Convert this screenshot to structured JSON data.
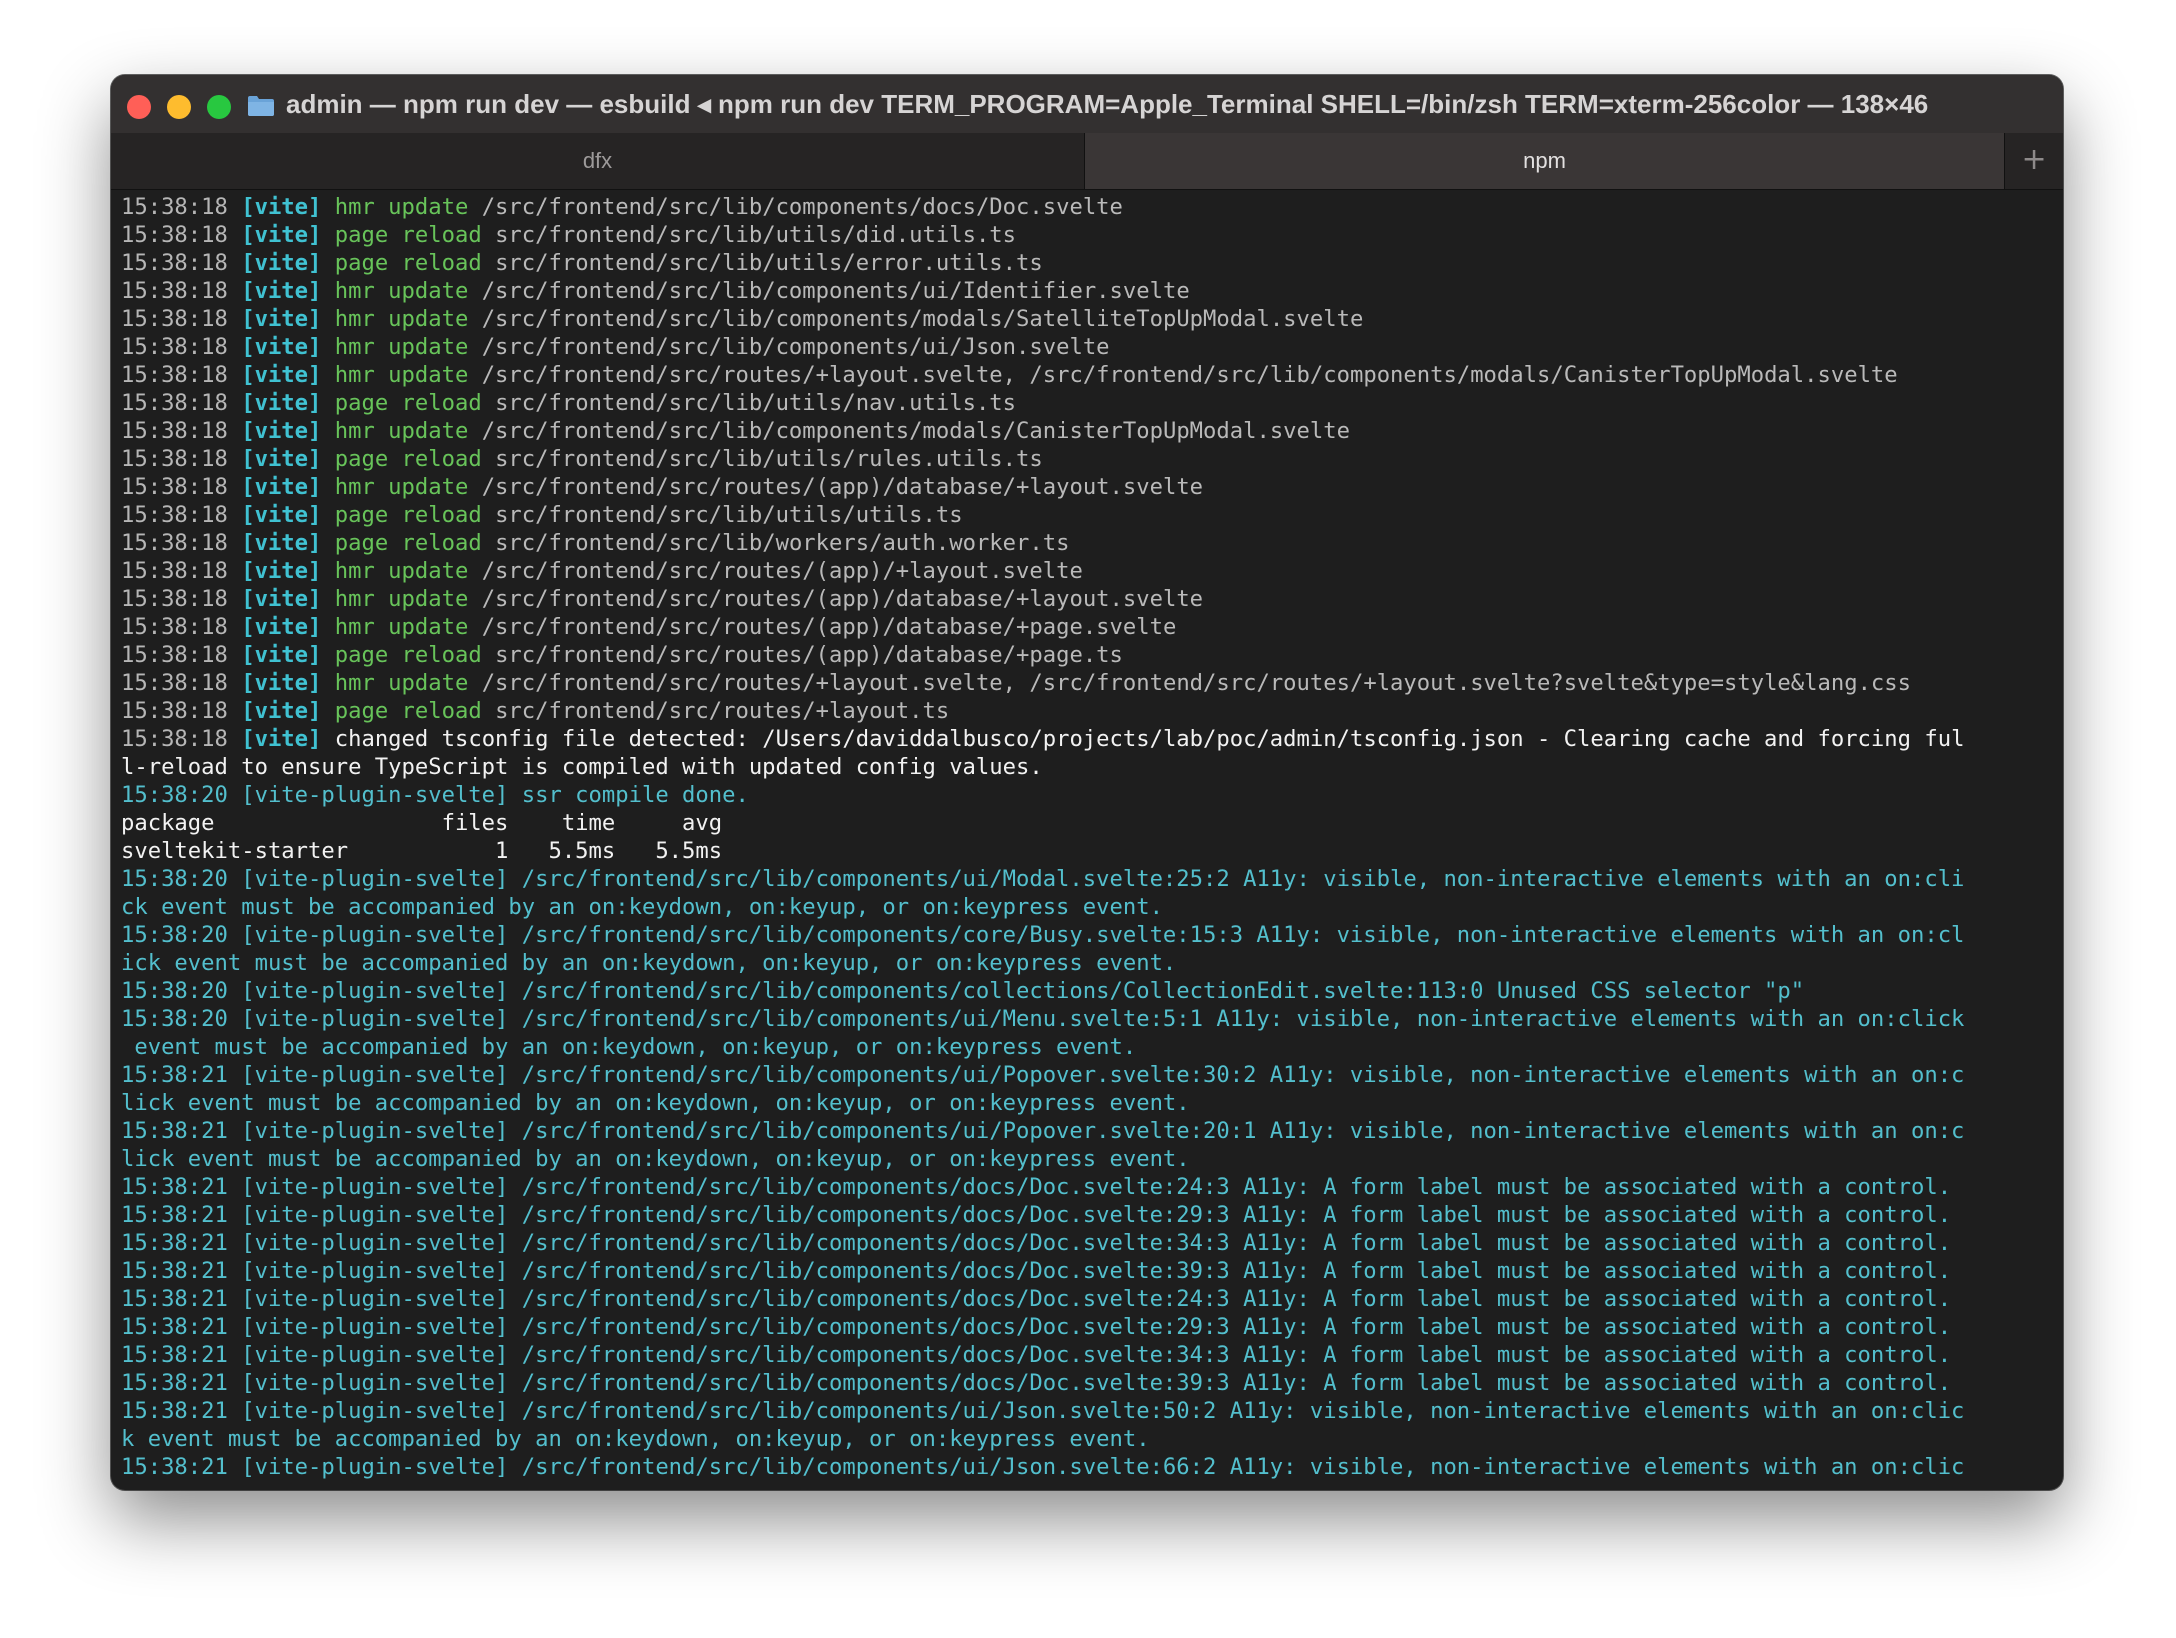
{
  "window": {
    "title": "admin — npm run dev — esbuild ◂ npm run dev TERM_PROGRAM=Apple_Terminal SHELL=/bin/zsh TERM=xterm-256color — 138×46",
    "folder_icon": "folder-icon",
    "colors": {
      "close": "#ff5f57",
      "minimize": "#febc2e",
      "maximize": "#28c840"
    }
  },
  "tabs": [
    {
      "label": "dfx",
      "active": false
    },
    {
      "label": "npm",
      "active": true
    }
  ],
  "new_tab_label": "+",
  "vite_lines": [
    {
      "ts": "15:38:18",
      "tag": "[vite]",
      "action": "hmr update",
      "path": "/src/frontend/src/lib/components/docs/Doc.svelte"
    },
    {
      "ts": "15:38:18",
      "tag": "[vite]",
      "action": "page reload",
      "path": "src/frontend/src/lib/utils/did.utils.ts"
    },
    {
      "ts": "15:38:18",
      "tag": "[vite]",
      "action": "page reload",
      "path": "src/frontend/src/lib/utils/error.utils.ts"
    },
    {
      "ts": "15:38:18",
      "tag": "[vite]",
      "action": "hmr update",
      "path": "/src/frontend/src/lib/components/ui/Identifier.svelte"
    },
    {
      "ts": "15:38:18",
      "tag": "[vite]",
      "action": "hmr update",
      "path": "/src/frontend/src/lib/components/modals/SatelliteTopUpModal.svelte"
    },
    {
      "ts": "15:38:18",
      "tag": "[vite]",
      "action": "hmr update",
      "path": "/src/frontend/src/lib/components/ui/Json.svelte"
    },
    {
      "ts": "15:38:18",
      "tag": "[vite]",
      "action": "hmr update",
      "path": "/src/frontend/src/routes/+layout.svelte, /src/frontend/src/lib/components/modals/CanisterTopUpModal.svelte"
    },
    {
      "ts": "15:38:18",
      "tag": "[vite]",
      "action": "page reload",
      "path": "src/frontend/src/lib/utils/nav.utils.ts"
    },
    {
      "ts": "15:38:18",
      "tag": "[vite]",
      "action": "hmr update",
      "path": "/src/frontend/src/lib/components/modals/CanisterTopUpModal.svelte"
    },
    {
      "ts": "15:38:18",
      "tag": "[vite]",
      "action": "page reload",
      "path": "src/frontend/src/lib/utils/rules.utils.ts"
    },
    {
      "ts": "15:38:18",
      "tag": "[vite]",
      "action": "hmr update",
      "path": "/src/frontend/src/routes/(app)/database/+layout.svelte"
    },
    {
      "ts": "15:38:18",
      "tag": "[vite]",
      "action": "page reload",
      "path": "src/frontend/src/lib/utils/utils.ts"
    },
    {
      "ts": "15:38:18",
      "tag": "[vite]",
      "action": "page reload",
      "path": "src/frontend/src/lib/workers/auth.worker.ts"
    },
    {
      "ts": "15:38:18",
      "tag": "[vite]",
      "action": "hmr update",
      "path": "/src/frontend/src/routes/(app)/+layout.svelte"
    },
    {
      "ts": "15:38:18",
      "tag": "[vite]",
      "action": "hmr update",
      "path": "/src/frontend/src/routes/(app)/database/+layout.svelte"
    },
    {
      "ts": "15:38:18",
      "tag": "[vite]",
      "action": "hmr update",
      "path": "/src/frontend/src/routes/(app)/database/+page.svelte"
    },
    {
      "ts": "15:38:18",
      "tag": "[vite]",
      "action": "page reload",
      "path": "src/frontend/src/routes/(app)/database/+page.ts"
    },
    {
      "ts": "15:38:18",
      "tag": "[vite]",
      "action": "hmr update",
      "path": "/src/frontend/src/routes/+layout.svelte, /src/frontend/src/routes/+layout.svelte?svelte&type=style&lang.css"
    },
    {
      "ts": "15:38:18",
      "tag": "[vite]",
      "action": "page reload",
      "path": "src/frontend/src/routes/+layout.ts"
    }
  ],
  "tsconfig_line": {
    "ts": "15:38:18",
    "tag": "[vite]",
    "text1": "changed tsconfig file detected: /Users/daviddalbusco/projects/lab/poc/admin/tsconfig.json - Clearing cache and forcing ful",
    "text2": "l-reload to ensure TypeScript is compiled with updated config values."
  },
  "compile_done": "15:38:20 [vite-plugin-svelte] ssr compile done.",
  "table": {
    "header": "package                 files    time     avg",
    "row": "sveltekit-starter           1   5.5ms   5.5ms"
  },
  "plugin_lines": [
    "15:38:20 [vite-plugin-svelte] /src/frontend/src/lib/components/ui/Modal.svelte:25:2 A11y: visible, non-interactive elements with an on:cli",
    "ck event must be accompanied by an on:keydown, on:keyup, or on:keypress event.",
    "15:38:20 [vite-plugin-svelte] /src/frontend/src/lib/components/core/Busy.svelte:15:3 A11y: visible, non-interactive elements with an on:cl",
    "ick event must be accompanied by an on:keydown, on:keyup, or on:keypress event.",
    "15:38:20 [vite-plugin-svelte] /src/frontend/src/lib/components/collections/CollectionEdit.svelte:113:0 Unused CSS selector \"p\"",
    "15:38:20 [vite-plugin-svelte] /src/frontend/src/lib/components/ui/Menu.svelte:5:1 A11y: visible, non-interactive elements with an on:click",
    " event must be accompanied by an on:keydown, on:keyup, or on:keypress event.",
    "15:38:21 [vite-plugin-svelte] /src/frontend/src/lib/components/ui/Popover.svelte:30:2 A11y: visible, non-interactive elements with an on:c",
    "lick event must be accompanied by an on:keydown, on:keyup, or on:keypress event.",
    "15:38:21 [vite-plugin-svelte] /src/frontend/src/lib/components/ui/Popover.svelte:20:1 A11y: visible, non-interactive elements with an on:c",
    "lick event must be accompanied by an on:keydown, on:keyup, or on:keypress event.",
    "15:38:21 [vite-plugin-svelte] /src/frontend/src/lib/components/docs/Doc.svelte:24:3 A11y: A form label must be associated with a control.",
    "15:38:21 [vite-plugin-svelte] /src/frontend/src/lib/components/docs/Doc.svelte:29:3 A11y: A form label must be associated with a control.",
    "15:38:21 [vite-plugin-svelte] /src/frontend/src/lib/components/docs/Doc.svelte:34:3 A11y: A form label must be associated with a control.",
    "15:38:21 [vite-plugin-svelte] /src/frontend/src/lib/components/docs/Doc.svelte:39:3 A11y: A form label must be associated with a control.",
    "15:38:21 [vite-plugin-svelte] /src/frontend/src/lib/components/docs/Doc.svelte:24:3 A11y: A form label must be associated with a control.",
    "15:38:21 [vite-plugin-svelte] /src/frontend/src/lib/components/docs/Doc.svelte:29:3 A11y: A form label must be associated with a control.",
    "15:38:21 [vite-plugin-svelte] /src/frontend/src/lib/components/docs/Doc.svelte:34:3 A11y: A form label must be associated with a control.",
    "15:38:21 [vite-plugin-svelte] /src/frontend/src/lib/components/docs/Doc.svelte:39:3 A11y: A form label must be associated with a control.",
    "15:38:21 [vite-plugin-svelte] /src/frontend/src/lib/components/ui/Json.svelte:50:2 A11y: visible, non-interactive elements with an on:clic",
    "k event must be accompanied by an on:keydown, on:keyup, or on:keypress event.",
    "15:38:21 [vite-plugin-svelte] /src/frontend/src/lib/components/ui/Json.svelte:66:2 A11y: visible, non-interactive elements with an on:clic"
  ]
}
